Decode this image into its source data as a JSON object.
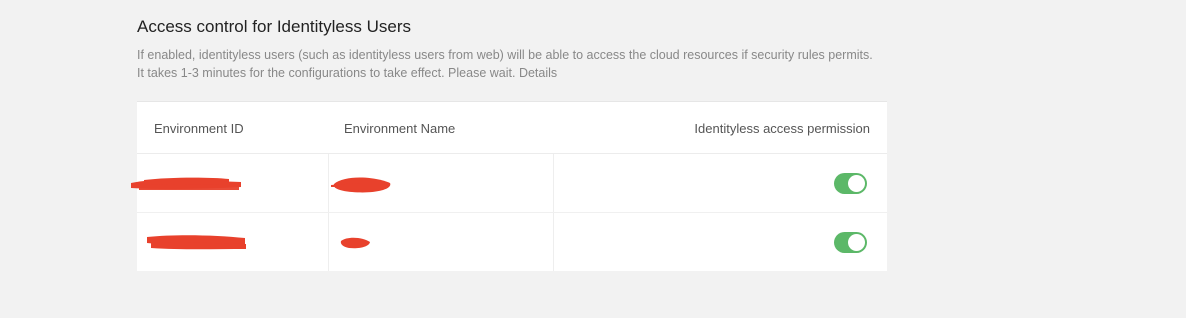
{
  "section": {
    "title": "Access control for Identityless Users",
    "description": "If enabled, identityless users (such as identityless users from web) will be able to access the cloud resources if security rules permits. It takes 1-3 minutes for the configurations to take effect. Please wait.",
    "details_link": "Details"
  },
  "table": {
    "columns": [
      "Environment ID",
      "Environment Name",
      "Identityless access permission"
    ],
    "rows": [
      {
        "environment_id": "[redacted]",
        "environment_name": "[redacted]",
        "identityless_access_enabled": true
      },
      {
        "environment_id": "[redacted]",
        "environment_name": "[redacted]",
        "identityless_access_enabled": true
      }
    ]
  },
  "colors": {
    "toggle_on": "#5cb868",
    "redaction": "#e8412c",
    "page_background": "#f2f2f2"
  }
}
